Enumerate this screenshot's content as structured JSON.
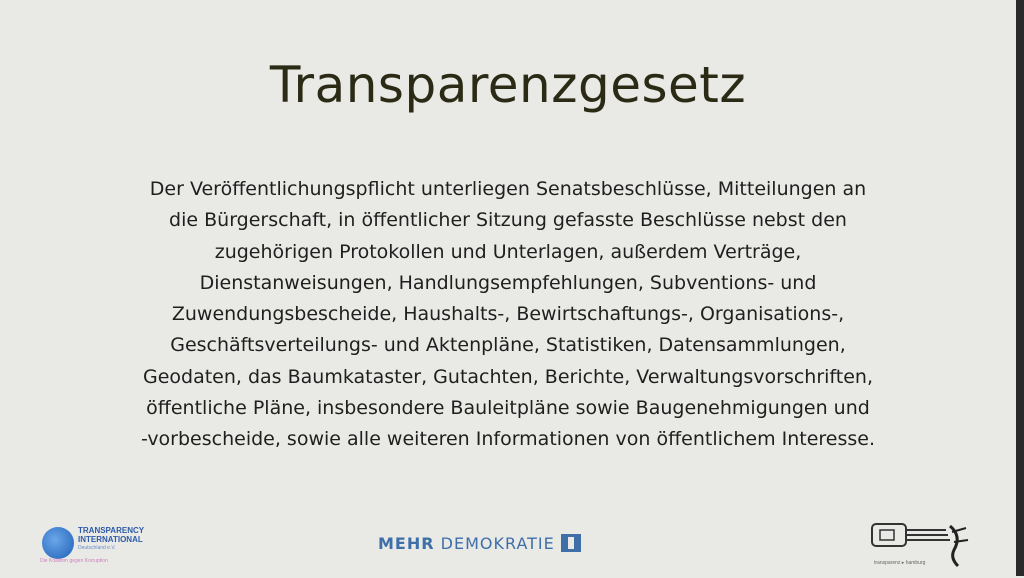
{
  "slide": {
    "title": "Transparenzgesetz",
    "body_lines": [
      "Der Veröffentlichungspflicht unterliegen Senatsbeschlüsse, Mitteilungen an",
      "die Bürgerschaft, in öffentlicher Sitzung gefasste Beschlüsse nebst den",
      "zugehörigen Protokollen und Unterlagen, außerdem Verträge,",
      "Dienstanweisungen, Handlungsempfehlungen, Subventions- und",
      "Zuwendungsbescheide, Haushalts-, Bewirtschaftungs-, Organisations-,",
      "Geschäftsverteilungs- und Aktenpläne, Statistiken, Datensammlungen,",
      "Geodaten, das Baumkataster, Gutachten, Berichte, Verwaltungsvorschriften,",
      "öffentliche Pläne, insbesondere Bauleitpläne sowie Baugenehmigungen und",
      "-vorbescheide, sowie alle weiteren Informationen von öffentlichem Interesse."
    ]
  },
  "logos": {
    "transparency": {
      "line1": "TRANSPARENCY",
      "line2": "INTERNATIONAL",
      "sub": "Deutschland e.V.",
      "slogan": "Die Koalition gegen Korruption",
      "icon": "globe-icon"
    },
    "mehr_demokratie": {
      "bold": "MEHR",
      "rest": " DEMOKRATIE"
    },
    "right_logo": {
      "caption": "transparenz ▸ hamburg"
    }
  },
  "colors": {
    "background": "#e9e9e6",
    "title": "#2b2b15",
    "body": "#1f1f1f",
    "mehr_demokratie_blue": "#3e6fa8"
  }
}
